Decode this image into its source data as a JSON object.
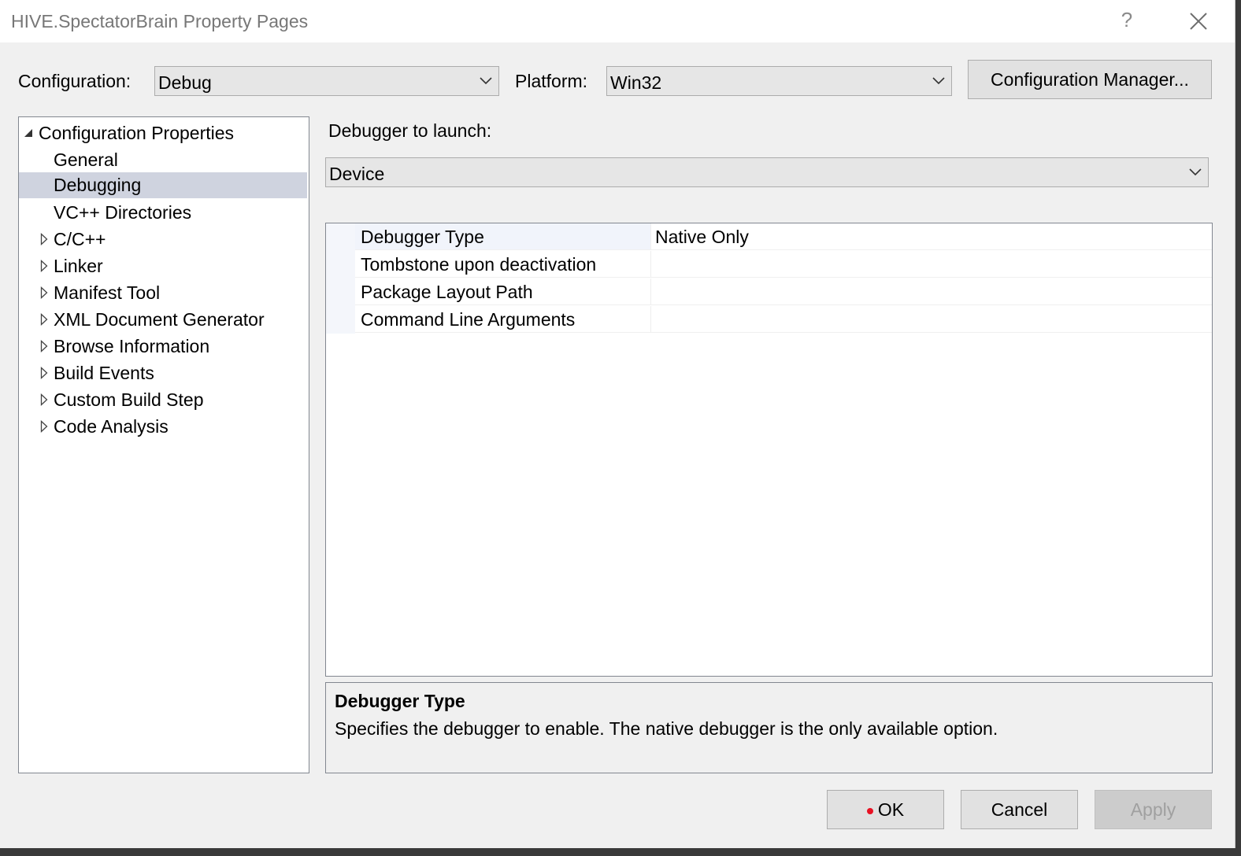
{
  "window": {
    "title": "HIVE.SpectatorBrain Property Pages",
    "help_label": "?"
  },
  "toolbar": {
    "configuration_label": "Configuration:",
    "configuration_value": "Debug",
    "platform_label": "Platform:",
    "platform_value": "Win32",
    "config_manager_label": "Configuration Manager..."
  },
  "tree": {
    "items": [
      {
        "label": "Configuration Properties",
        "expanded": true,
        "level": 0
      },
      {
        "label": "General",
        "level": 1
      },
      {
        "label": "Debugging",
        "level": 1,
        "selected": true
      },
      {
        "label": "VC++ Directories",
        "level": 1
      },
      {
        "label": "C/C++",
        "level": 1,
        "expandable": true
      },
      {
        "label": "Linker",
        "level": 1,
        "expandable": true
      },
      {
        "label": "Manifest Tool",
        "level": 1,
        "expandable": true
      },
      {
        "label": "XML Document Generator",
        "level": 1,
        "expandable": true
      },
      {
        "label": "Browse Information",
        "level": 1,
        "expandable": true
      },
      {
        "label": "Build Events",
        "level": 1,
        "expandable": true
      },
      {
        "label": "Custom Build Step",
        "level": 1,
        "expandable": true
      },
      {
        "label": "Code Analysis",
        "level": 1,
        "expandable": true
      }
    ]
  },
  "debugger": {
    "launch_label": "Debugger to launch:",
    "launch_value": "Device"
  },
  "properties": [
    {
      "name": "Debugger Type",
      "value": "Native Only"
    },
    {
      "name": "Tombstone upon deactivation",
      "value": ""
    },
    {
      "name": "Package Layout Path",
      "value": ""
    },
    {
      "name": "Command Line Arguments",
      "value": ""
    }
  ],
  "description": {
    "title": "Debugger Type",
    "text": "Specifies the debugger to enable. The native debugger is the only available option."
  },
  "buttons": {
    "ok": "OK",
    "cancel": "Cancel",
    "apply": "Apply"
  },
  "colors": {
    "selection": "#cfd3df",
    "dialog_bg": "#f0f0f0",
    "ok_dot": "#e81123",
    "apply_disabled_text": "#a0a0a0"
  }
}
